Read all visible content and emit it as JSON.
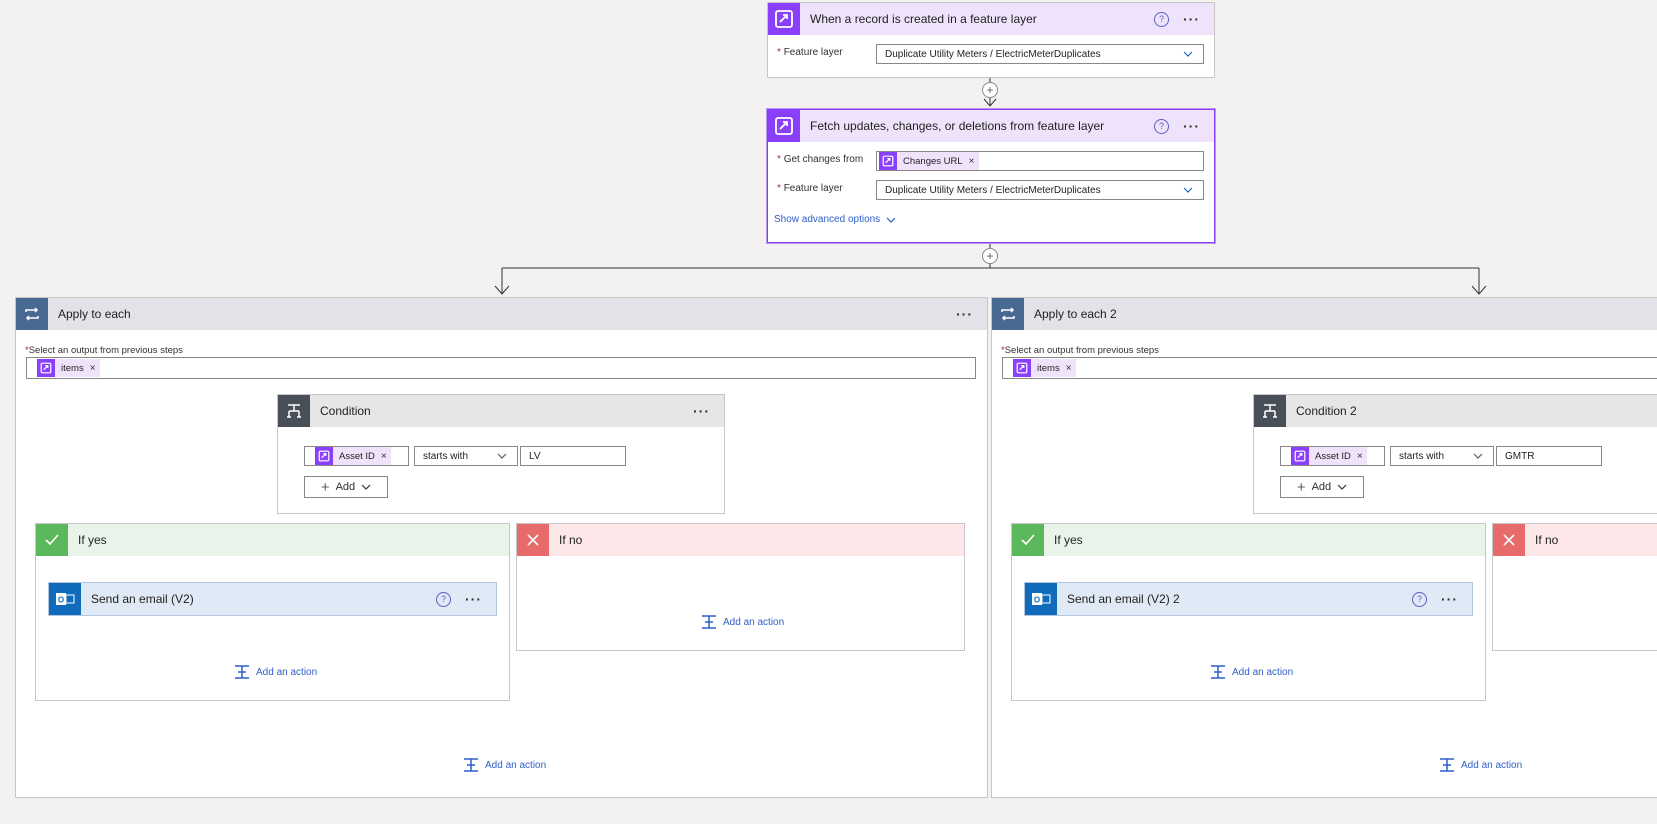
{
  "trigger": {
    "title": "When a record is created in a feature layer",
    "help": "?",
    "feature_layer_label": "Feature layer",
    "feature_layer_value": "Duplicate Utility Meters / ElectricMeterDuplicates"
  },
  "fetch": {
    "title": "Fetch updates, changes, or deletions from feature layer",
    "help": "?",
    "get_changes_label": "Get changes from",
    "get_changes_token": "Changes URL",
    "feature_layer_label": "Feature layer",
    "feature_layer_value": "Duplicate Utility Meters / ElectricMeterDuplicates",
    "advanced_link": "Show advanced options"
  },
  "loops": [
    {
      "title": "Apply to each",
      "select_label": "Select an output from previous steps",
      "items_token": "items",
      "condition": {
        "title": "Condition",
        "token": "Asset ID",
        "operator": "starts with",
        "value": "LV",
        "add_label": "Add"
      },
      "yes_title": "If yes",
      "no_title": "If no",
      "email_title": "Send an email (V2)",
      "add_action": "Add an action"
    },
    {
      "title": "Apply to each 2",
      "select_label": "Select an output from previous steps",
      "items_token": "items",
      "condition": {
        "title": "Condition 2",
        "token": "Asset ID",
        "operator": "starts with",
        "value": "GMTR",
        "add_label": "Add"
      },
      "yes_title": "If yes",
      "no_title": "If no",
      "email_title": "Send an email (V2) 2",
      "add_action": "Add an action"
    }
  ],
  "required_marker": "*",
  "token_remove": "×",
  "colors": {
    "accent_purple": "#8a3ffc",
    "link_blue": "#2e5ec8",
    "loop_blue": "#486991",
    "yes_green": "#5cb85c",
    "no_red": "#e86b6b",
    "outlook_blue": "#0f6cbd"
  }
}
